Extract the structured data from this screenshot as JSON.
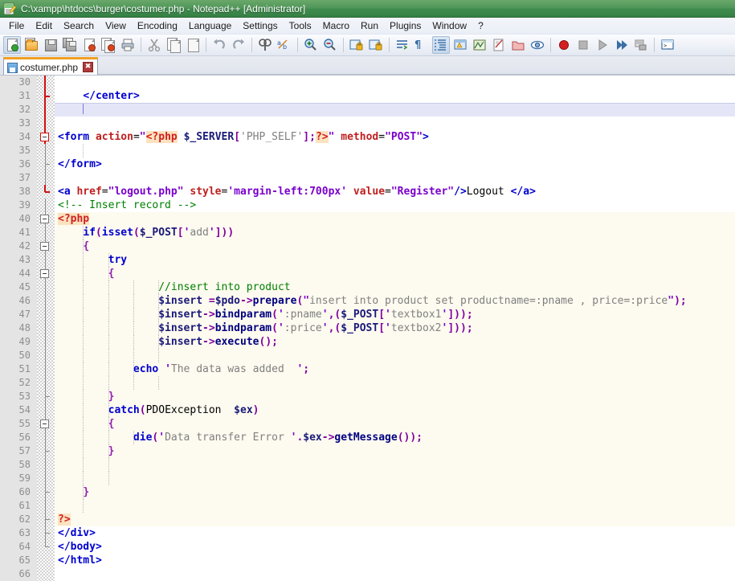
{
  "window": {
    "title": "C:\\xampp\\htdocs\\burger\\costumer.php - Notepad++ [Administrator]",
    "icon": "notepad-plus-plus-icon"
  },
  "menu": {
    "items": [
      {
        "label": "File"
      },
      {
        "label": "Edit"
      },
      {
        "label": "Search"
      },
      {
        "label": "View"
      },
      {
        "label": "Encoding"
      },
      {
        "label": "Language"
      },
      {
        "label": "Settings"
      },
      {
        "label": "Tools"
      },
      {
        "label": "Macro"
      },
      {
        "label": "Run"
      },
      {
        "label": "Plugins"
      },
      {
        "label": "Window"
      },
      {
        "label": "?"
      }
    ]
  },
  "toolbar": {
    "buttons": [
      {
        "name": "new-file-icon"
      },
      {
        "name": "open-file-icon"
      },
      {
        "name": "save-icon"
      },
      {
        "name": "save-all-icon"
      },
      {
        "name": "close-file-icon"
      },
      {
        "name": "close-all-files-icon"
      },
      {
        "name": "print-icon"
      },
      {
        "name": "separator-1"
      },
      {
        "name": "cut-icon"
      },
      {
        "name": "copy-icon"
      },
      {
        "name": "paste-icon"
      },
      {
        "name": "separator-2"
      },
      {
        "name": "undo-icon"
      },
      {
        "name": "redo-icon"
      },
      {
        "name": "separator-3"
      },
      {
        "name": "find-icon"
      },
      {
        "name": "replace-icon"
      },
      {
        "name": "separator-4"
      },
      {
        "name": "zoom-in-icon"
      },
      {
        "name": "zoom-out-icon"
      },
      {
        "name": "separator-5"
      },
      {
        "name": "sync-vertical-scroll-icon"
      },
      {
        "name": "sync-horizontal-scroll-icon"
      },
      {
        "name": "separator-6"
      },
      {
        "name": "word-wrap-icon"
      },
      {
        "name": "show-all-characters-icon"
      },
      {
        "name": "indent-guide-icon"
      },
      {
        "name": "user-defined-dialog-icon"
      },
      {
        "name": "document-map-icon"
      },
      {
        "name": "function-list-icon"
      },
      {
        "name": "folder-as-workspace-icon"
      },
      {
        "name": "monitoring-icon"
      },
      {
        "name": "separator-7"
      },
      {
        "name": "start-record-macro-icon"
      },
      {
        "name": "stop-record-macro-icon"
      },
      {
        "name": "playback-macro-icon"
      },
      {
        "name": "run-macro-multiple-icon"
      },
      {
        "name": "save-macro-icon"
      },
      {
        "name": "separator-8"
      },
      {
        "name": "run-icon"
      }
    ]
  },
  "tabs": [
    {
      "label": "costumer.php",
      "active": true,
      "icon": "saved-file-icon",
      "close": "✖"
    }
  ],
  "editor": {
    "first_line": 30,
    "current_line": 32,
    "lines": [
      {
        "n": 30,
        "indent": 0,
        "text": "",
        "php": false
      },
      {
        "n": 31,
        "indent": 0,
        "text": "    </center>",
        "php": false
      },
      {
        "n": 32,
        "indent": 0,
        "text": "    ",
        "php": false,
        "current": true
      },
      {
        "n": 33,
        "indent": 0,
        "text": "",
        "php": false
      },
      {
        "n": 34,
        "indent": 0,
        "text": "<form action=\"<?php $_SERVER['PHP_SELF'];?>\" method=\"POST\">",
        "php": false
      },
      {
        "n": 35,
        "indent": 0,
        "text": "",
        "php": false
      },
      {
        "n": 36,
        "indent": 0,
        "text": "</form>",
        "php": false
      },
      {
        "n": 37,
        "indent": 0,
        "text": "",
        "php": false
      },
      {
        "n": 38,
        "indent": 0,
        "text": "<a href=\"logout.php\" style='margin-left:700px' value=\"Register\"/>Logout </a>",
        "php": false
      },
      {
        "n": 39,
        "indent": 0,
        "text": "<!-- Insert record -->",
        "php": false
      },
      {
        "n": 40,
        "indent": 0,
        "text": "<?php",
        "php": true
      },
      {
        "n": 41,
        "indent": 0,
        "text": "    if(isset($_POST['add']))",
        "php": true
      },
      {
        "n": 42,
        "indent": 0,
        "text": "    {",
        "php": true
      },
      {
        "n": 43,
        "indent": 0,
        "text": "        try",
        "php": true
      },
      {
        "n": 44,
        "indent": 0,
        "text": "        {",
        "php": true
      },
      {
        "n": 45,
        "indent": 0,
        "text": "                //insert into product",
        "php": true
      },
      {
        "n": 46,
        "indent": 0,
        "text": "                $insert =$pdo->prepare(\"insert into product set productname=:pname , price=:price\");",
        "php": true
      },
      {
        "n": 47,
        "indent": 0,
        "text": "                $insert->bindparam(':pname',($_POST['textbox1']));",
        "php": true
      },
      {
        "n": 48,
        "indent": 0,
        "text": "                $insert->bindparam(':price',($_POST['textbox2']));",
        "php": true
      },
      {
        "n": 49,
        "indent": 0,
        "text": "                $insert->execute();",
        "php": true
      },
      {
        "n": 50,
        "indent": 0,
        "text": "",
        "php": true
      },
      {
        "n": 51,
        "indent": 0,
        "text": "            echo 'The data was added  ';",
        "php": true
      },
      {
        "n": 52,
        "indent": 0,
        "text": "",
        "php": true
      },
      {
        "n": 53,
        "indent": 0,
        "text": "        }",
        "php": true
      },
      {
        "n": 54,
        "indent": 0,
        "text": "        catch(PDOException  $ex)",
        "php": true
      },
      {
        "n": 55,
        "indent": 0,
        "text": "        {",
        "php": true
      },
      {
        "n": 56,
        "indent": 0,
        "text": "            die('Data transfer Error '.$ex->getMessage());",
        "php": true
      },
      {
        "n": 57,
        "indent": 0,
        "text": "        }",
        "php": true
      },
      {
        "n": 58,
        "indent": 0,
        "text": "",
        "php": true
      },
      {
        "n": 59,
        "indent": 0,
        "text": "",
        "php": true
      },
      {
        "n": 60,
        "indent": 0,
        "text": "    }",
        "php": true
      },
      {
        "n": 61,
        "indent": 0,
        "text": "",
        "php": true
      },
      {
        "n": 62,
        "indent": 0,
        "text": "?>",
        "php": true
      },
      {
        "n": 63,
        "indent": 0,
        "text": "</div>",
        "php": false
      },
      {
        "n": 64,
        "indent": 0,
        "text": "</body>",
        "php": false
      },
      {
        "n": 65,
        "indent": 0,
        "text": "</html>",
        "php": false
      },
      {
        "n": 66,
        "indent": 0,
        "text": "",
        "php": false
      }
    ]
  },
  "colors": {
    "titlebar_green": "#3f8a4d",
    "tab_active_accent": "#f0a024",
    "php_block_bg": "#fdfaef",
    "current_line_bg": "#e4e6f7",
    "fold_highlight": "#d01010",
    "tag": "#0000d0",
    "attribute": "#c02020",
    "string": "#7a00cc",
    "comment": "#008000",
    "php_marker": "#d02020",
    "operator": "#8000a0"
  }
}
